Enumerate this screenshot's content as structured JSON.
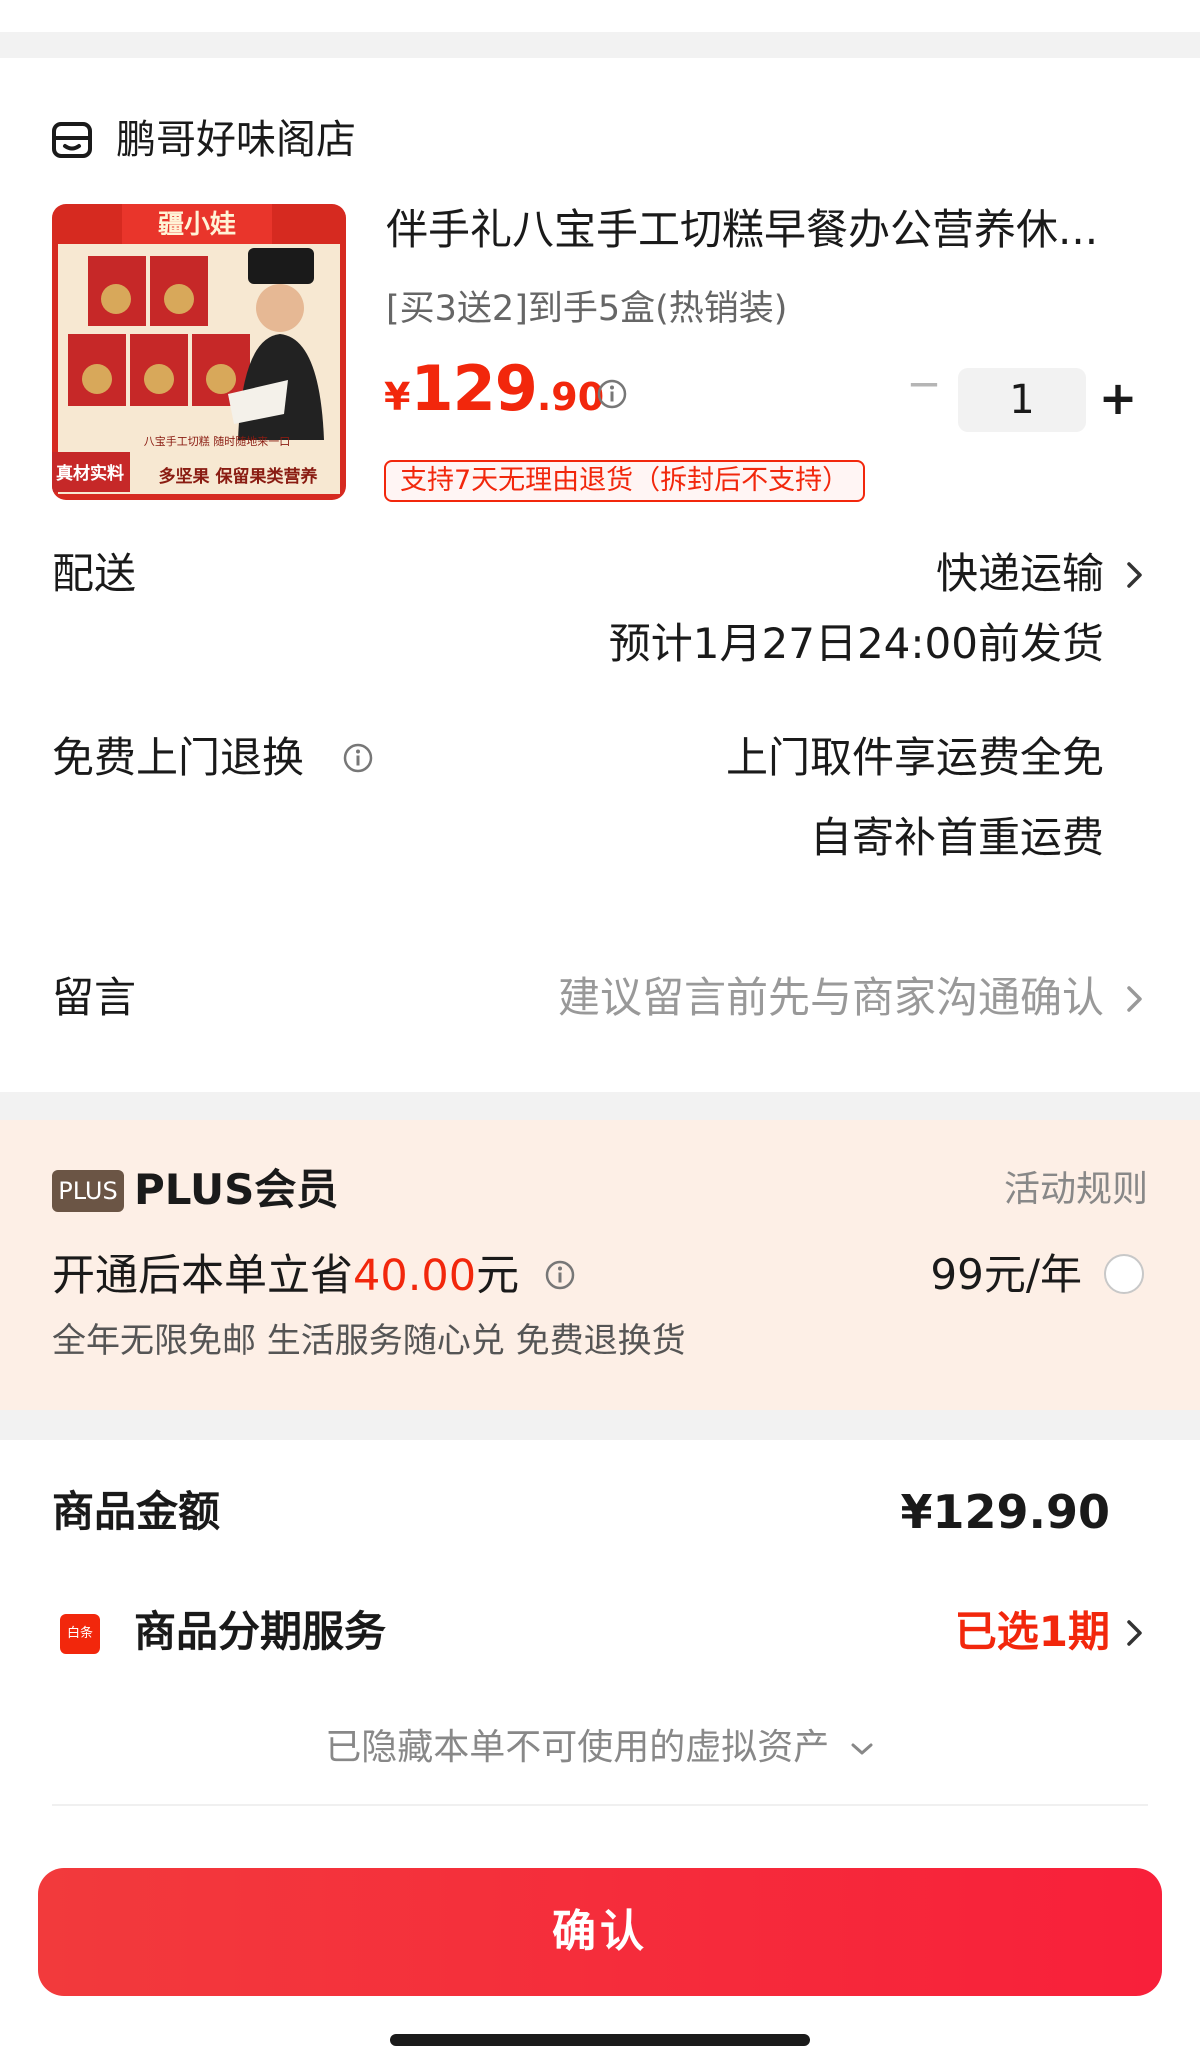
{
  "shop": {
    "name": "鹏哥好味阁店"
  },
  "product": {
    "brand_on_image": "疆小娃",
    "image_tag": "真材实料",
    "image_caption": "多坚果 保留果类营养",
    "image_subcaption": "八宝手工切糕 随时随地来一口",
    "title": "伴手礼八宝手工切糕早餐办公营养休...",
    "spec": "[买3送2]到手5盒(热销装)",
    "price_currency": "¥",
    "price_integer": "129",
    "price_decimal": ".90",
    "quantity": "1",
    "quantity_minus": "−",
    "quantity_plus": "+",
    "return_policy": "支持7天无理由退货（拆封后不支持）"
  },
  "delivery": {
    "label": "配送",
    "method": "快递运输",
    "estimate": "预计1月27日24:00前发货"
  },
  "free_return": {
    "label": "免费上门退换",
    "line1": "上门取件享运费全免",
    "line2": "自寄补首重运费"
  },
  "message": {
    "label": "留言",
    "placeholder": "建议留言前先与商家沟通确认"
  },
  "plus": {
    "logo": "PLUS",
    "title": "PLUS会员",
    "rules": "活动规则",
    "save_prefix": "开通后本单立省",
    "save_amount": "40.00",
    "save_suffix": "元",
    "price": "99元/年",
    "benefits": "全年无限免邮 生活服务随心兑 免费退换货"
  },
  "summary": {
    "goods_amount_label": "商品金额",
    "goods_amount_value": "¥129.90",
    "installment_icon": "白条",
    "installment_label": "商品分期服务",
    "installment_value": "已选1期",
    "hidden_assets_note": "已隐藏本单不可使用的虚拟资产"
  },
  "confirm_button": "确认",
  "colors": {
    "accent": "#f2270c",
    "plus_bg": "#fdefe6",
    "plus_logo": "#6b5545"
  }
}
